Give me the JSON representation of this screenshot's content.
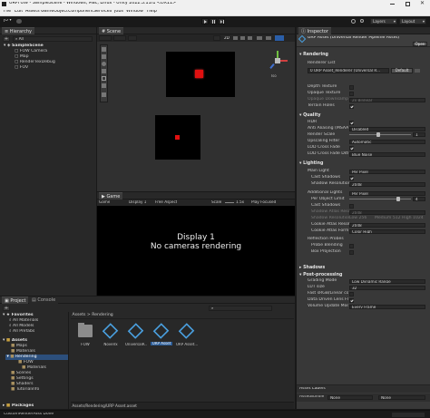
{
  "window": {
    "title": "URPFOW - SampleScene - Windows, Mac, Linux - Unity 2022.3.11f1 <DX11>"
  },
  "menu": [
    "File",
    "Edit",
    "Assets",
    "GameObject",
    "Component",
    "Services",
    "Jobs",
    "Window",
    "Help"
  ],
  "toolbar": {
    "account": "JO ▾",
    "layers": "Layers",
    "layout": "Layout"
  },
  "hierarchy": {
    "tab": "Hierarchy",
    "search_placeholder": "All",
    "scene": "SampleScene",
    "items": [
      "FOW Camera",
      "Map",
      "RenderTexDebug",
      "FOV"
    ]
  },
  "scene": {
    "tab": "Scene",
    "mode": "2D",
    "persp": "Iso",
    "colors": {
      "view_bg": "#303030",
      "quad_bg": "#000000",
      "dot": "#e01010"
    }
  },
  "game": {
    "tab": "Game",
    "mode": "Game",
    "display": "Display 1",
    "aspect": "Free Aspect",
    "scale_label": "Scale",
    "scale_value": "1.5x",
    "play_mode": "Play Focused",
    "message_line1": "Display 1",
    "message_line2": "No cameras rendering"
  },
  "project": {
    "tabs": [
      "Project",
      "Console"
    ],
    "breadcrumb": [
      "Assets",
      "Rendering"
    ],
    "tree": {
      "favorites": "Favorites",
      "favorite_items": [
        "All Materials",
        "All Models",
        "All Prefabs"
      ],
      "assets": "Assets",
      "asset_items": [
        "Maps",
        "Materials",
        "Rendering",
        "FOW",
        "Materials",
        "Scenes",
        "Settings",
        "Shaders",
        "Tutorialinfo"
      ],
      "packages": "Packages"
    },
    "assets": [
      {
        "name": "FOW",
        "icon": "folder-icon"
      },
      {
        "name": "Novelrx",
        "icon": "render-asset-icon"
      },
      {
        "name": "UniversalR...",
        "icon": "render-asset-icon"
      },
      {
        "name": "URP Asset",
        "icon": "render-asset-icon"
      },
      {
        "name": "URP Asset...",
        "icon": "render-asset-icon"
      }
    ],
    "selected_asset": "URP Asset",
    "path": "Assets/Rendering/URP Asset.asset"
  },
  "status": {
    "text": "CustomRenderPass Done"
  },
  "inspector": {
    "tab": "Inspector",
    "title": "URP Asset (Universal Render Pipeline Asset)",
    "open_button": "Open",
    "sections": {
      "rendering": "Rendering",
      "renderer_list": "Renderer List",
      "renderer_item": "0  URP Asset_Renderer (Universal R...",
      "default_btn": "Default",
      "depth_texture": "Depth Texture",
      "opaque_texture": "Opaque Texture",
      "opaque_downsampling": "Opaque Downsampling",
      "opaque_downsampling_value": "2x Bilinear",
      "terrain_holes": "Terrain Holes",
      "quality": "Quality",
      "hdr": "HDR",
      "anti_aliasing": "Anti Aliasing (MSAA)",
      "anti_aliasing_value": "Disabled",
      "render_scale": "Render Scale",
      "render_scale_value": "1",
      "upscaling_filter": "Upscaling Filter",
      "upscaling_filter_value": "Automatic",
      "lod_cross_fade": "LOD Cross Fade",
      "lod_cross_fade_dither": "LOD Cross Fade Dith",
      "lod_cross_fade_dither_value": "Blue Noise",
      "lighting": "Lighting",
      "main_light": "Main Light",
      "main_light_value": "Per Pixel",
      "cast_shadows": "Cast Shadows",
      "shadow_resolution": "Shadow Resolution",
      "shadow_resolution_value": "2048",
      "additional_lights": "Additional Lights",
      "additional_lights_value": "Per Pixel",
      "per_object_limit": "Per Object Limit",
      "per_object_limit_value": "4",
      "cast_shadows_2": "Cast Shadows",
      "shadow_atlas_res": "Shadow Atlas Reso",
      "shadow_atlas_res_value": "2048",
      "shadow_res_tiers": "Shadow Resolution Tiers",
      "tier_low": "Low 256",
      "tier_medium": "Medium 512",
      "tier_high": "High 1024",
      "cookie_atlas_res": "Cookie Atlas Resolu",
      "cookie_atlas_res_value": "2048",
      "cookie_atlas_format": "Cookie Atlas Form",
      "cookie_atlas_format_value": "Color High",
      "reflection_probes": "Reflection Probes",
      "probe_blending": "Probe Blending",
      "box_projection": "Box Projection",
      "shadows": "Shadows",
      "post_processing": "Post-processing",
      "grading_mode": "Grading Mode",
      "grading_mode_value": "Low Dynamic Range",
      "lut_size": "LUT size",
      "lut_size_value": "32",
      "fast_srgb": "Fast sRGB/Linear con",
      "data_driven_lens": "Data Driven Lens Fla",
      "volume_update_mode": "Volume Update Mode",
      "volume_update_mode_value": "Every Frame"
    },
    "asset_labels": "Asset Labels",
    "asset_bundle": "AssetBundle",
    "asset_bundle_value": "None",
    "asset_bundle_value2": "None"
  }
}
